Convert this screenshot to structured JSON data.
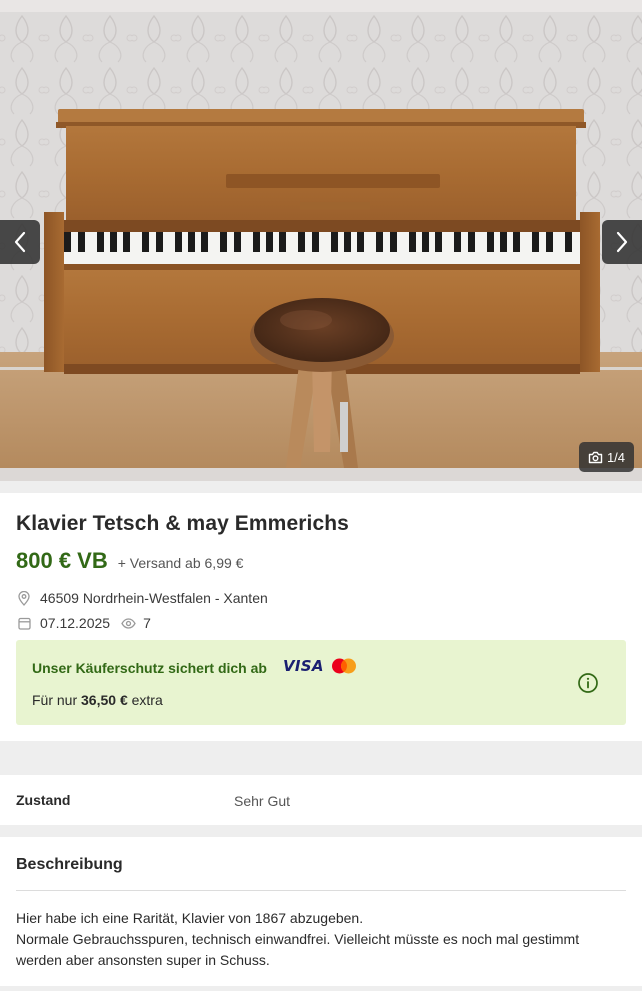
{
  "gallery": {
    "image_subject": "piano-with-stool-photo",
    "counter_text": "1/4",
    "prev_icon": "chevron-left-icon",
    "next_icon": "chevron-right-icon",
    "camera_icon": "camera-icon"
  },
  "listing": {
    "title": "Klavier Tetsch & may Emmerichs",
    "price": "800 € VB",
    "shipping": "+ Versand ab 6,99 €",
    "location": "46509 Nordrhein-Westfalen - Xanten",
    "date": "07.12.2025",
    "views": "7"
  },
  "buyer_protection": {
    "headline": "Unser Käuferschutz sichert dich ab",
    "visa_label": "VISA",
    "sub_prefix": "Für nur",
    "sub_amount": "36,50 €",
    "sub_suffix": "extra",
    "info_icon": "info-icon"
  },
  "details": {
    "condition_label": "Zustand",
    "condition_value": "Sehr Gut"
  },
  "description": {
    "heading": "Beschreibung",
    "line1": "Hier habe ich eine Rarität, Klavier von 1867 abzugeben.",
    "line2": "Normale Gebrauchsspuren, technisch einwandfrei. Vielleicht müsste es noch mal gestimmt werden aber ansonsten super in Schuss."
  },
  "colors": {
    "price_green": "#326916",
    "protection_bg": "#e8f4d0",
    "page_bg": "#eeeeee"
  }
}
